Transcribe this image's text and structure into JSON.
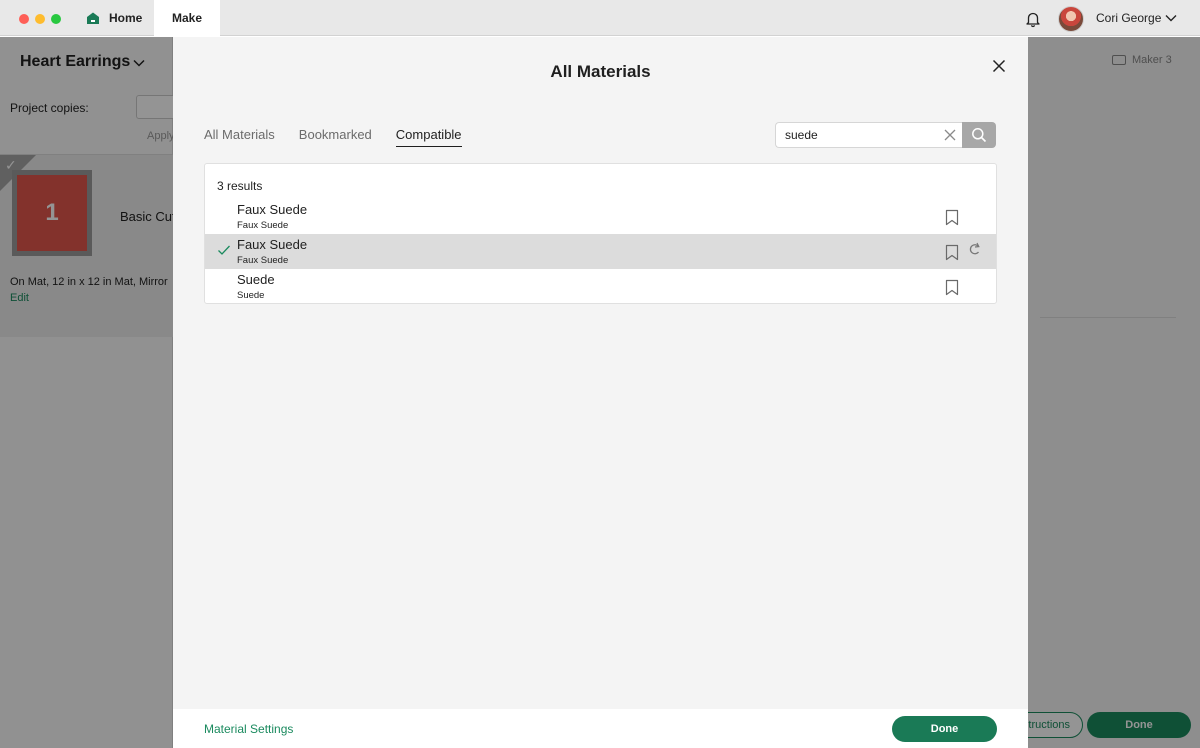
{
  "titlebar": {
    "home_tab": "Home",
    "make_tab": "Make",
    "user_name": "Cori George"
  },
  "background": {
    "project_title": "Heart Earrings",
    "project_copies_label": "Project copies:",
    "apply_label": "Apply",
    "mat_number": "1",
    "mat_name": "Basic Cut",
    "mat_description": "On Mat, 12 in x 12 in Mat, Mirror",
    "edit_link": "Edit",
    "machine": "Maker 3",
    "instructions_button": "Instructions",
    "done_button": "Done"
  },
  "modal": {
    "title": "All Materials",
    "tabs": [
      {
        "label": "All Materials",
        "active": false
      },
      {
        "label": "Bookmarked",
        "active": false
      },
      {
        "label": "Compatible",
        "active": true
      }
    ],
    "search": {
      "value": "suede",
      "placeholder": "Search"
    },
    "results_count": "3 results",
    "results": [
      {
        "title": "Faux Suede",
        "subtitle": "Faux Suede",
        "selected": false
      },
      {
        "title": "Faux Suede",
        "subtitle": "Faux Suede",
        "selected": true
      },
      {
        "title": "Suede",
        "subtitle": "Suede",
        "selected": false
      }
    ],
    "footer": {
      "material_settings": "Material Settings",
      "done_button": "Done"
    }
  },
  "colors": {
    "accent_green": "#1a7a56",
    "selected_row": "#dcdcdc"
  }
}
